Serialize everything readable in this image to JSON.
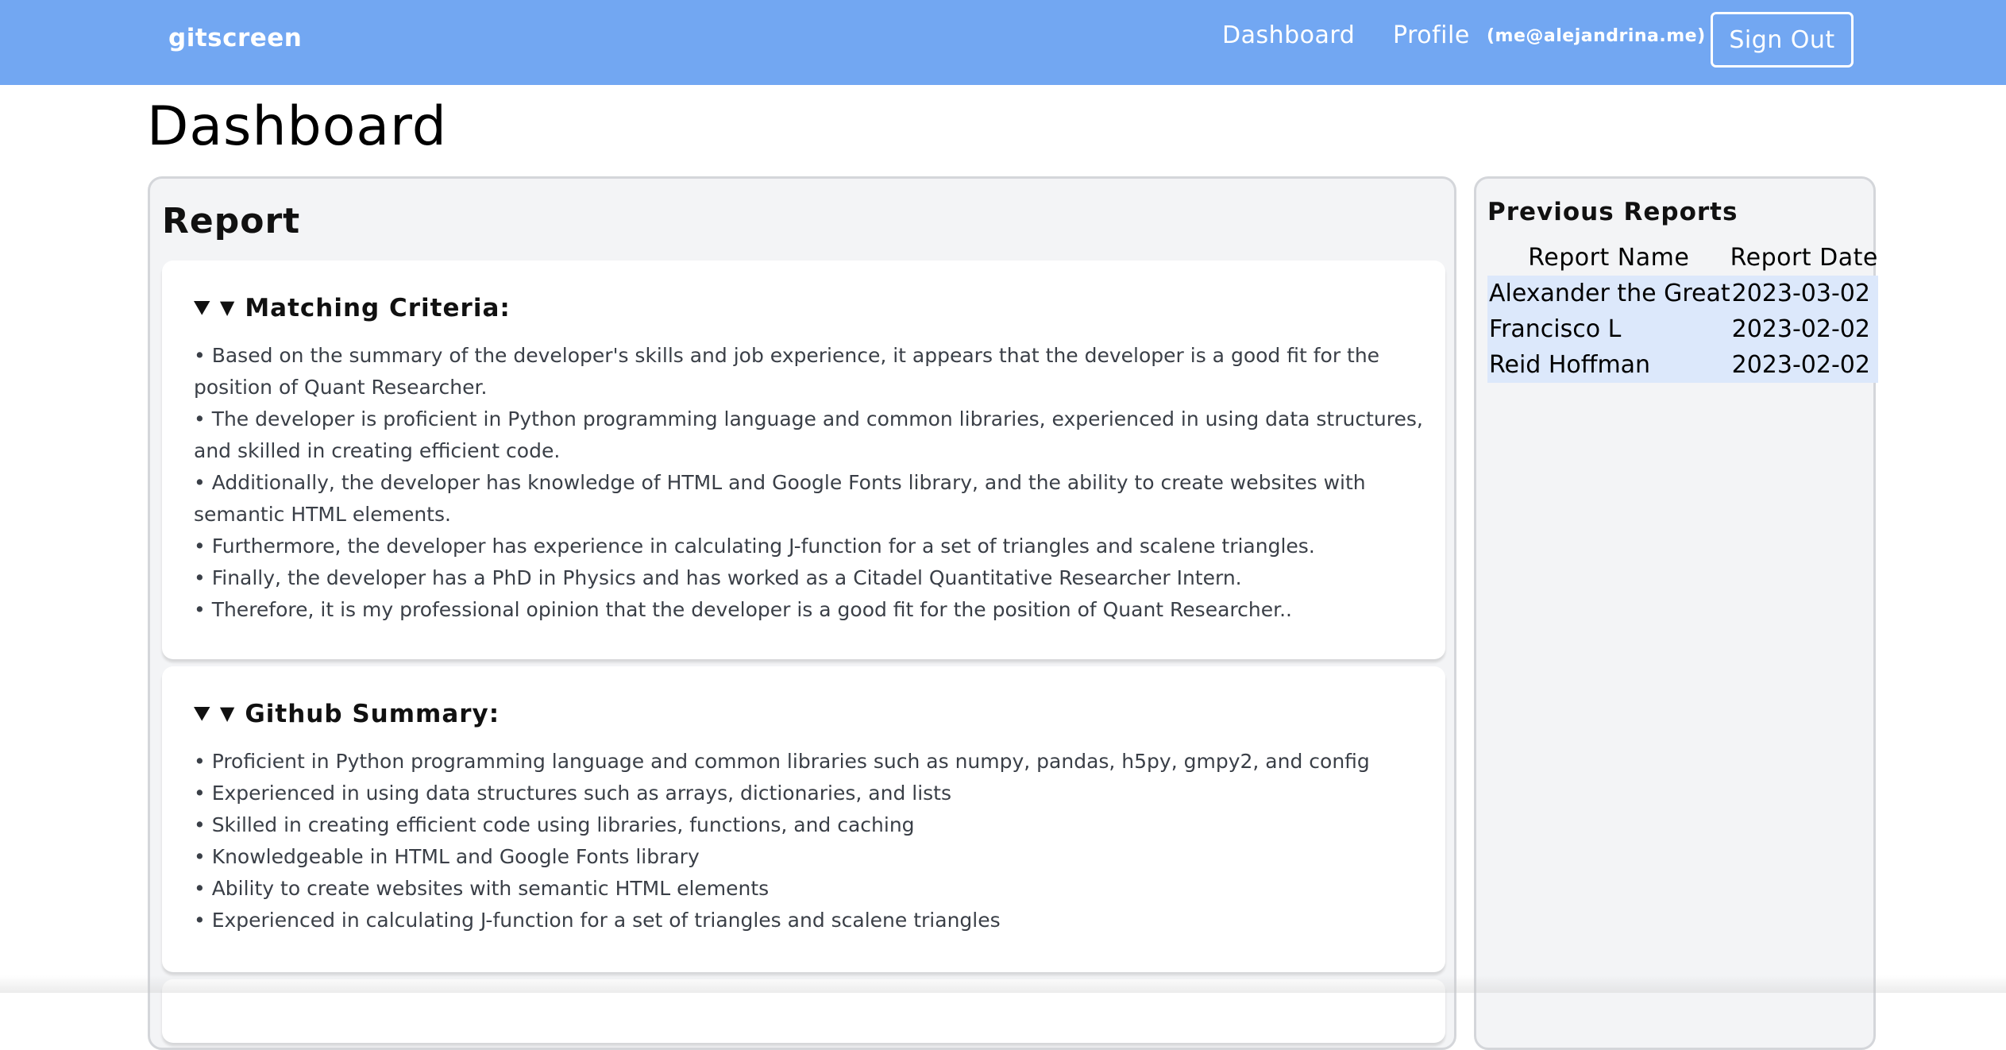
{
  "navbar": {
    "brand": "gitscreen",
    "links": {
      "dashboard": "Dashboard",
      "profile": "Profile"
    },
    "email": "(me@alejandrina.me)",
    "sign_out": "Sign Out",
    "background_color": "#72a7f2"
  },
  "page": {
    "title": "Dashboard"
  },
  "report": {
    "heading": "Report",
    "sections": [
      {
        "title": "Matching Criteria:",
        "items": [
          "• Based on the summary of the developer's skills and job experience, it appears that the developer is a good fit for the position of Quant Researcher.",
          "• The developer is proficient in Python programming language and common libraries, experienced in using data structures, and skilled in creating efficient code.",
          "• Additionally, the developer has knowledge of HTML and Google Fonts library, and the ability to create websites with semantic HTML elements.",
          "• Furthermore, the developer has experience in calculating J-function for a set of triangles and scalene triangles.",
          "• Finally, the developer has a PhD in Physics and has worked as a Citadel Quantitative Researcher Intern.",
          "• Therefore, it is my professional opinion that the developer is a good fit for the position of Quant Researcher.."
        ]
      },
      {
        "title": "Github Summary:",
        "items": [
          "• Proficient in Python programming language and common libraries such as numpy, pandas, h5py, gmpy2, and config",
          "• Experienced in using data structures such as arrays, dictionaries, and lists",
          "• Skilled in creating efficient code using libraries, functions, and caching",
          "• Knowledgeable in HTML and Google Fonts library",
          "• Ability to create websites with semantic HTML elements",
          "• Experienced in calculating J-function for a set of triangles and scalene triangles"
        ]
      }
    ]
  },
  "previous_reports": {
    "heading": "Previous Reports",
    "columns": [
      "Report Name",
      "Report Date"
    ],
    "rows": [
      [
        "Alexander the Great",
        "2023-03-02"
      ],
      [
        "Francisco L",
        "2023-02-02"
      ],
      [
        "Reid Hoffman",
        "2023-02-02"
      ]
    ],
    "row_highlight_color": "#dce8fb"
  }
}
